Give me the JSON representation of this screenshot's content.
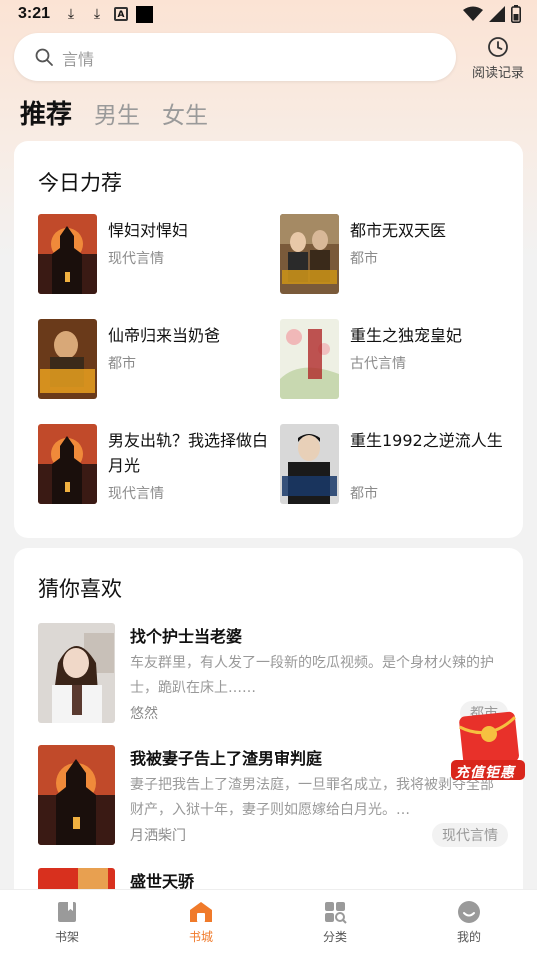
{
  "status": {
    "time": "3:21",
    "icons": [
      "download-icon",
      "download-icon",
      "a-box-icon",
      "black-square-icon"
    ],
    "right_icons": [
      "wifi-icon",
      "signal-icon",
      "battery-icon"
    ]
  },
  "search": {
    "placeholder": "言情",
    "icon": "search-icon"
  },
  "history": {
    "label": "阅读记录",
    "icon": "clock-icon"
  },
  "tabs": [
    {
      "label": "推荐",
      "active": true
    },
    {
      "label": "男生",
      "active": false
    },
    {
      "label": "女生",
      "active": false
    }
  ],
  "recommend": {
    "title": "今日力荐",
    "items": [
      {
        "title": "悍妇对悍妇",
        "genre": "现代言情"
      },
      {
        "title": "都市无双天医",
        "genre": "都市"
      },
      {
        "title": "仙帝归来当奶爸",
        "genre": "都市"
      },
      {
        "title": "重生之独宠皇妃",
        "genre": "古代言情"
      },
      {
        "title": "男友出轨？我选择做白月光",
        "genre": "现代言情"
      },
      {
        "title": "重生1992之逆流人生",
        "genre": "都市"
      }
    ]
  },
  "guess": {
    "title": "猜你喜欢",
    "items": [
      {
        "title": "找个护士当老婆",
        "desc": "车友群里，有人发了一段新的吃瓜视频。是个身材火辣的护士，跪趴在床上……",
        "author": "悠然",
        "tag": "都市"
      },
      {
        "title": "我被妻子告上了渣男审判庭",
        "desc": "妻子把我告上了渣男法庭，一旦罪名成立，我将被剥夺全部财产，入狱十年，妻子则如愿嫁给白月光。…",
        "author": "月洒柴门",
        "tag": "现代言情"
      },
      {
        "title": "盛世天骄",
        "desc": "",
        "author": "",
        "tag": ""
      }
    ]
  },
  "promo": {
    "label": "充值钜惠"
  },
  "nav": [
    {
      "label": "书架",
      "icon": "bookshelf-icon",
      "active": false
    },
    {
      "label": "书城",
      "icon": "bookstore-icon",
      "active": true
    },
    {
      "label": "分类",
      "icon": "category-icon",
      "active": false
    },
    {
      "label": "我的",
      "icon": "profile-icon",
      "active": false
    }
  ],
  "colors": {
    "accent": "#f07a2a",
    "promo_red": "#e8312a",
    "text_primary": "#111111",
    "text_secondary": "#8b8b8b"
  }
}
